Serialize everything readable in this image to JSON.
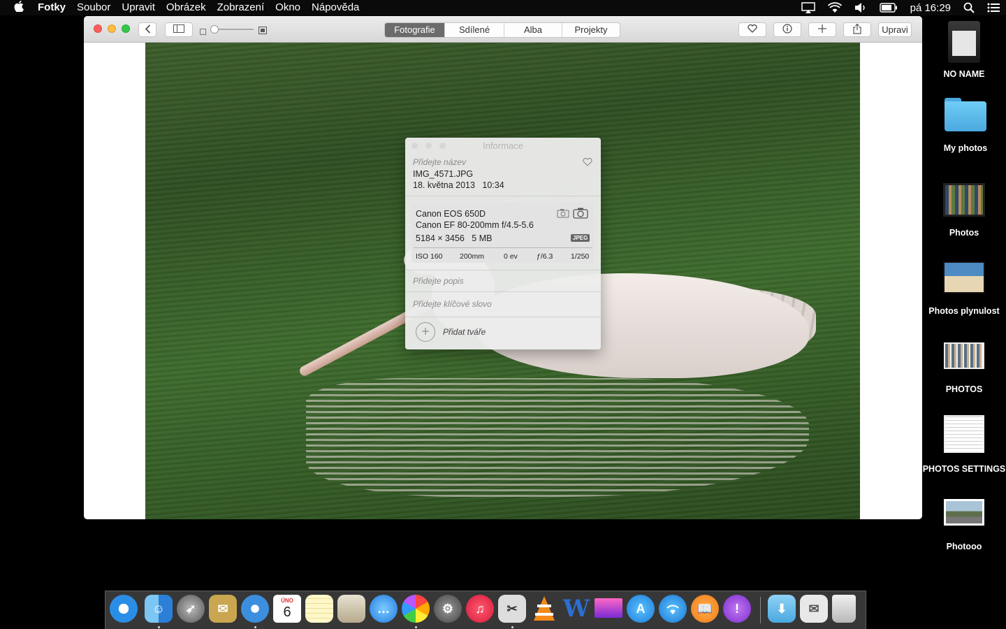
{
  "menubar": {
    "app_name": "Fotky",
    "items": [
      "Soubor",
      "Upravit",
      "Obrázek",
      "Zobrazení",
      "Okno",
      "Nápověda"
    ],
    "clock": "pá 16:29"
  },
  "toolbar": {
    "tabs": [
      "Fotografie",
      "Sdílené",
      "Alba",
      "Projekty"
    ],
    "active_tab": "Fotografie",
    "edit_label": "Upravi"
  },
  "info_panel": {
    "title": "Informace",
    "title_placeholder": "Přidejte název",
    "filename": "IMG_4571.JPG",
    "date": "18. května 2013",
    "time": "10:34",
    "camera": "Canon EOS 650D",
    "lens": "Canon EF 80-200mm f/4.5-5.6",
    "dimensions": "5184 × 3456",
    "size": "5 MB",
    "format": "JPEG",
    "iso": "ISO 160",
    "focal_length": "200mm",
    "exposure_bias": "0 ev",
    "aperture": "ƒ/6.3",
    "shutter": "1/250",
    "description_placeholder": "Přidejte popis",
    "keyword_placeholder": "Přidejte klíčové slovo",
    "add_faces_label": "Přidat tváře"
  },
  "desktop_icons": [
    {
      "label": "NO NAME",
      "icon": "sd-card-icon"
    },
    {
      "label": "My photos",
      "icon": "folder-icon"
    },
    {
      "label": "Photos",
      "icon": "photos-thumbnail"
    },
    {
      "label": "Photos plynulost",
      "icon": "photo-thumbnail"
    },
    {
      "label": "PHOTOS",
      "icon": "screenshot-thumbnail"
    },
    {
      "label": "PHOTOS SETTINGS",
      "icon": "document-thumbnail"
    },
    {
      "label": "Photooo",
      "icon": "photo-thumbnail"
    }
  ],
  "dock": {
    "calendar_month": "ÚNO",
    "calendar_day": "6",
    "apps": [
      "safari-icon",
      "finder-icon",
      "launchpad-icon",
      "mail-icon",
      "safari-icon",
      "calendar-icon",
      "notes-icon",
      "preview-icon",
      "messages-icon",
      "photos-icon",
      "system-preferences-icon",
      "itunes-icon",
      "screenshot-tool-icon",
      "vlc-icon",
      "word-icon",
      "monitor-icon",
      "app-store-icon",
      "wifi-icon",
      "ibooks-icon",
      "feedback-icon",
      "downloads-folder-icon",
      "mail-stack-icon",
      "trash-icon"
    ]
  },
  "colors": {
    "toolbar_active_tab": "#6b6b6b",
    "close": "#fc605c",
    "minimize": "#fdbc40",
    "zoom": "#34c84a",
    "folder_blue": "#5ac0f0"
  }
}
